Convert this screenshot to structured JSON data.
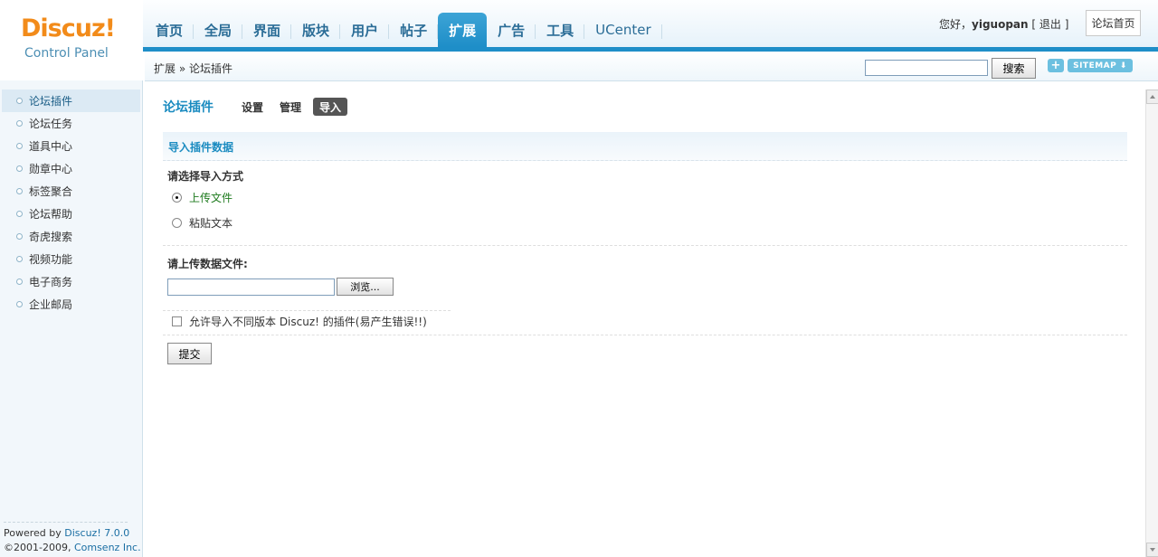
{
  "logo": {
    "brand": "Discuz!",
    "subtitle": "Control Panel"
  },
  "nav": {
    "items": [
      "首页",
      "全局",
      "界面",
      "版块",
      "用户",
      "帖子",
      "扩展",
      "广告",
      "工具",
      "UCenter"
    ],
    "active": "扩展"
  },
  "user": {
    "greeting": "您好，",
    "name": "yiguopan",
    "logout": "[ 退出 ]",
    "home_button": "论坛首页"
  },
  "subbar": {
    "breadcrumb": "扩展 » 论坛插件",
    "search_button": "搜索",
    "plus_label": "+",
    "sitemap_label": "SITEMAP ⬇"
  },
  "sidebar": {
    "items": [
      "论坛插件",
      "论坛任务",
      "道具中心",
      "勋章中心",
      "标签聚合",
      "论坛帮助",
      "奇虎搜索",
      "视频功能",
      "电子商务",
      "企业邮局"
    ],
    "active": "论坛插件",
    "footer_powered": "Powered by ",
    "footer_brand": "Discuz! 7.0.0",
    "footer_copy": "©2001-2009, ",
    "footer_company": "Comsenz Inc."
  },
  "main": {
    "title": "论坛插件",
    "tabs": [
      "设置",
      "管理",
      "导入"
    ],
    "active_tab": "导入",
    "section_title": "导入插件数据",
    "choose_method": "请选择导入方式",
    "option_upload": "上传文件",
    "option_paste": "粘贴文本",
    "upload_label": "请上传数据文件:",
    "browse_button": "浏览...",
    "allow_label": "允许导入不同版本 Discuz! 的插件(易产生错误!!)",
    "submit_button": "提交"
  }
}
